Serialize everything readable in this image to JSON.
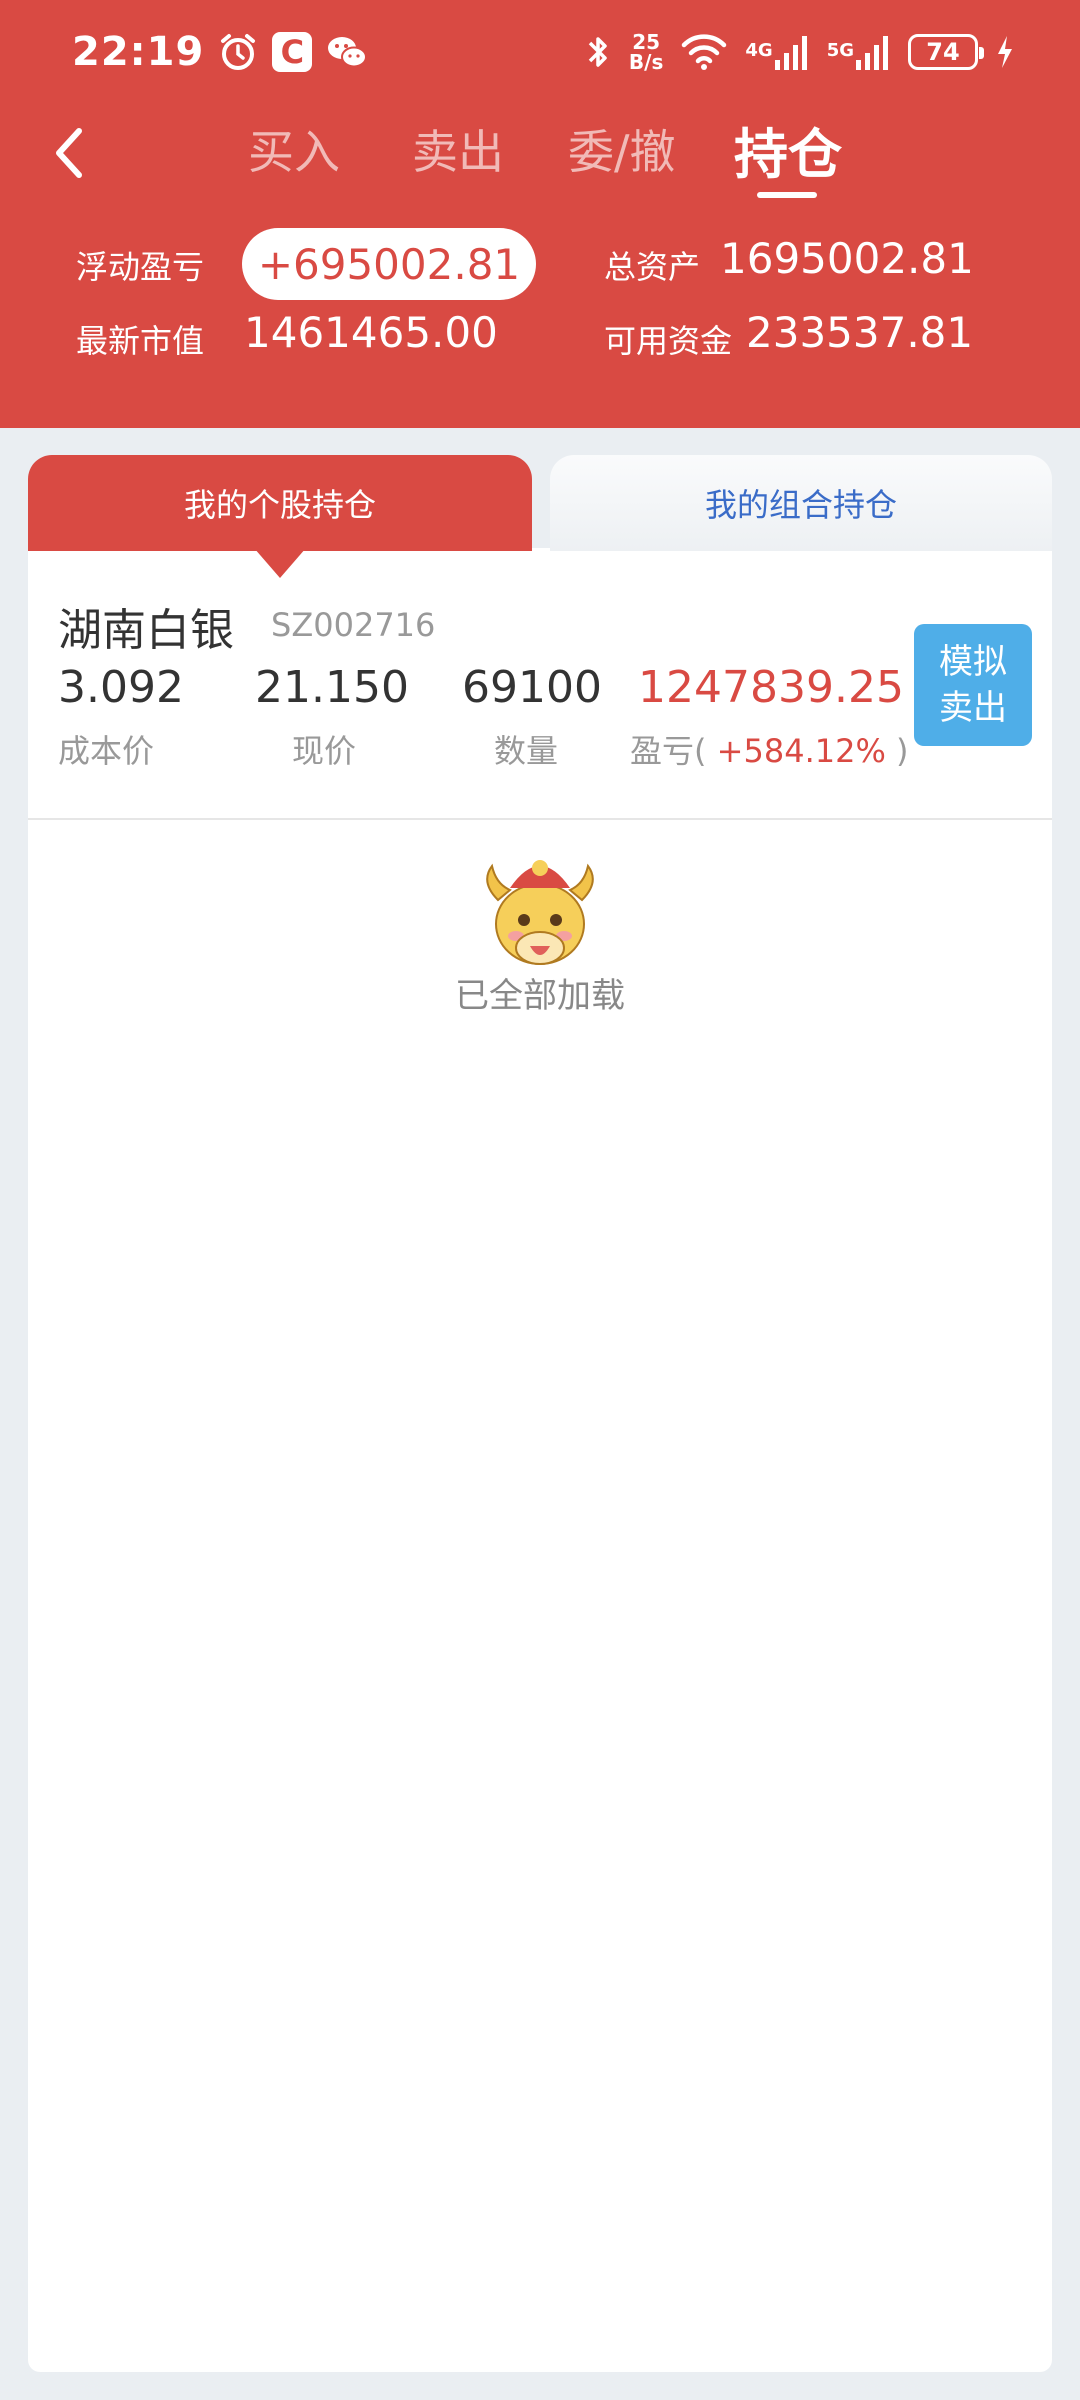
{
  "status_bar": {
    "time": "22:19",
    "net_speed_top": "25",
    "net_speed_bottom": "B/s",
    "sig1_label": "4G",
    "sig2_label": "5G",
    "battery": "74",
    "icons": [
      "alarm-icon",
      "app-c-icon",
      "wechat-icon",
      "bluetooth-icon",
      "wifi-icon",
      "signal-icon",
      "battery-icon",
      "charging-icon"
    ]
  },
  "nav": {
    "tabs": [
      {
        "label": "买入"
      },
      {
        "label": "卖出"
      },
      {
        "label": "委/撤"
      },
      {
        "label": "持仓"
      }
    ],
    "active_tab": "持仓"
  },
  "summary": {
    "float_pnl_label": "浮动盈亏",
    "float_pnl_value": "+695002.81",
    "total_assets_label": "总资产",
    "total_assets_value": "1695002.81",
    "market_value_label": "最新市值",
    "market_value_value": "1461465.00",
    "available_funds_label": "可用资金",
    "available_funds_value": "233537.81"
  },
  "segments": {
    "stock_holdings": "我的个股持仓",
    "portfolio_holdings": "我的组合持仓"
  },
  "holding": {
    "name": "湖南白银",
    "code": "SZ002716",
    "cost_price": "3.092",
    "cost_price_label": "成本价",
    "current_price": "21.150",
    "current_price_label": "现价",
    "quantity": "69100",
    "quantity_label": "数量",
    "pnl": "1247839.25",
    "pnl_label_prefix": "盈亏(",
    "pnl_pct": "+584.12%",
    "pnl_label_suffix": ")",
    "sell_button_line1": "模拟",
    "sell_button_line2": "卖出"
  },
  "footer": {
    "all_loaded": "已全部加载"
  },
  "colors": {
    "brand_red": "#d94a43",
    "sell_blue": "#4faee8",
    "link_blue": "#3a6cc8"
  }
}
